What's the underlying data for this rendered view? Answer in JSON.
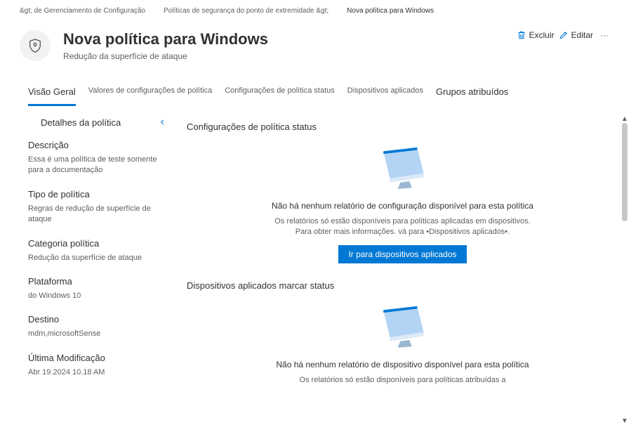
{
  "breadcrumb": {
    "a": "&gt; de Gerenciamento de Configuração",
    "b": "Políticas de segurança do ponto de extremidade &gt;",
    "c": "Nova política para Windows"
  },
  "header": {
    "title": "Nova política para Windows",
    "subtitle": "Redução da superfície de ataque",
    "delete_label": "Excluir",
    "edit_label": "Editar"
  },
  "tabs": {
    "overview": "Visão Geral",
    "settings": "Valores de configurações de política",
    "status": "Configurações de política status",
    "devices": "Dispositivos aplicados",
    "groups": "Grupos atribuídos"
  },
  "sidebar": {
    "title": "Detalhes da política",
    "fields": [
      {
        "label": "Descrição",
        "value": "Essa é uma política de teste somente para a documentação"
      },
      {
        "label": "Tipo de política",
        "value": "Regras de redução de superfície de ataque"
      },
      {
        "label": "Categoria política",
        "value": "Redução da superfície de ataque"
      },
      {
        "label": "Plataforma",
        "value": "do Windows 10"
      },
      {
        "label": "Destino",
        "value": "mdm,microsoftSense"
      },
      {
        "label": "Última Modificação",
        "value": "Abr 19.2024 10.18 AM"
      }
    ]
  },
  "main": {
    "section1": {
      "title": "Configurações de política status",
      "empty_title": "Não há nenhum relatório de configuração disponível para esta política",
      "empty_desc": "Os relatórios só estão disponíveis para políticas aplicadas em dispositivos. Para obter mais informações. vá para •Dispositivos aplicados•.",
      "button": "Ir para dispositivos aplicados"
    },
    "section2": {
      "title": "Dispositivos aplicados marcar status",
      "empty_title": "Não há nenhum relatório de dispositivo disponível para esta política",
      "empty_desc": "Os relatórios só estão disponíveis para políticas atribuídas a"
    }
  }
}
